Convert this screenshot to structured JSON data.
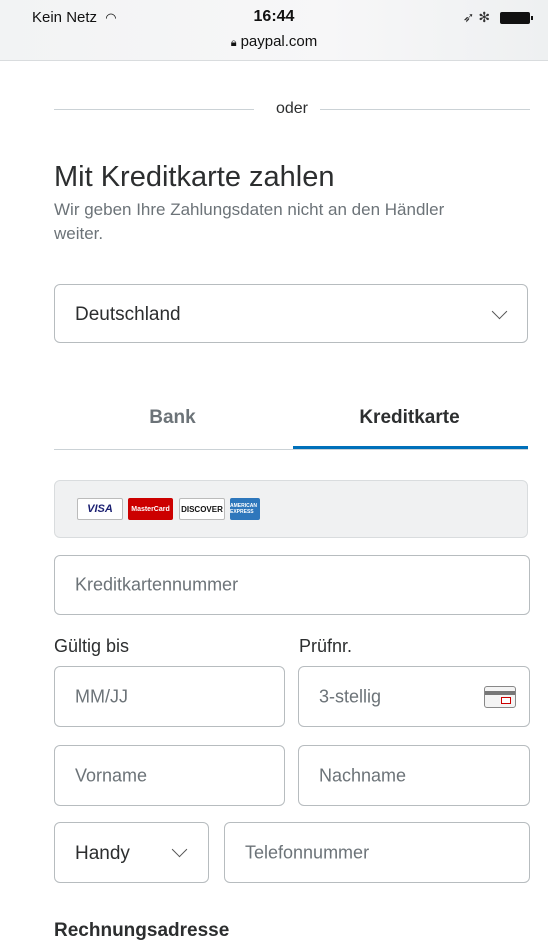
{
  "status_bar": {
    "carrier": "Kein Netz",
    "time": "16:44",
    "url": "paypal.com",
    "location_glyph": "➶",
    "bluetooth_glyph": "✻"
  },
  "divider_text": "oder",
  "title": "Mit Kreditkarte zahlen",
  "subtitle": "Wir geben Ihre Zahlungsdaten nicht an den Händler weiter.",
  "country": {
    "selected": "Deutschland"
  },
  "tabs": [
    {
      "label": "Bank",
      "active": false
    },
    {
      "label": "Kreditkarte",
      "active": true
    }
  ],
  "card_logos": {
    "visa": "VISA",
    "mastercard": "MasterCard",
    "discover": "DISCOVER",
    "amex": "AMERICAN EXPRESS"
  },
  "form": {
    "card_number_placeholder": "Kreditkartennummer",
    "expiry_label": "Gültig bis",
    "expiry_placeholder": "MM/JJ",
    "cvv_label": "Prüfnr.",
    "cvv_placeholder": "3-stellig",
    "first_name_placeholder": "Vorname",
    "last_name_placeholder": "Nachname",
    "phone_type": "Handy",
    "phone_placeholder": "Telefonnummer"
  },
  "billing_heading": "Rechnungsadresse",
  "colors": {
    "accent": "#0070ba",
    "text": "#2c2e2f",
    "muted": "#6c7378"
  }
}
